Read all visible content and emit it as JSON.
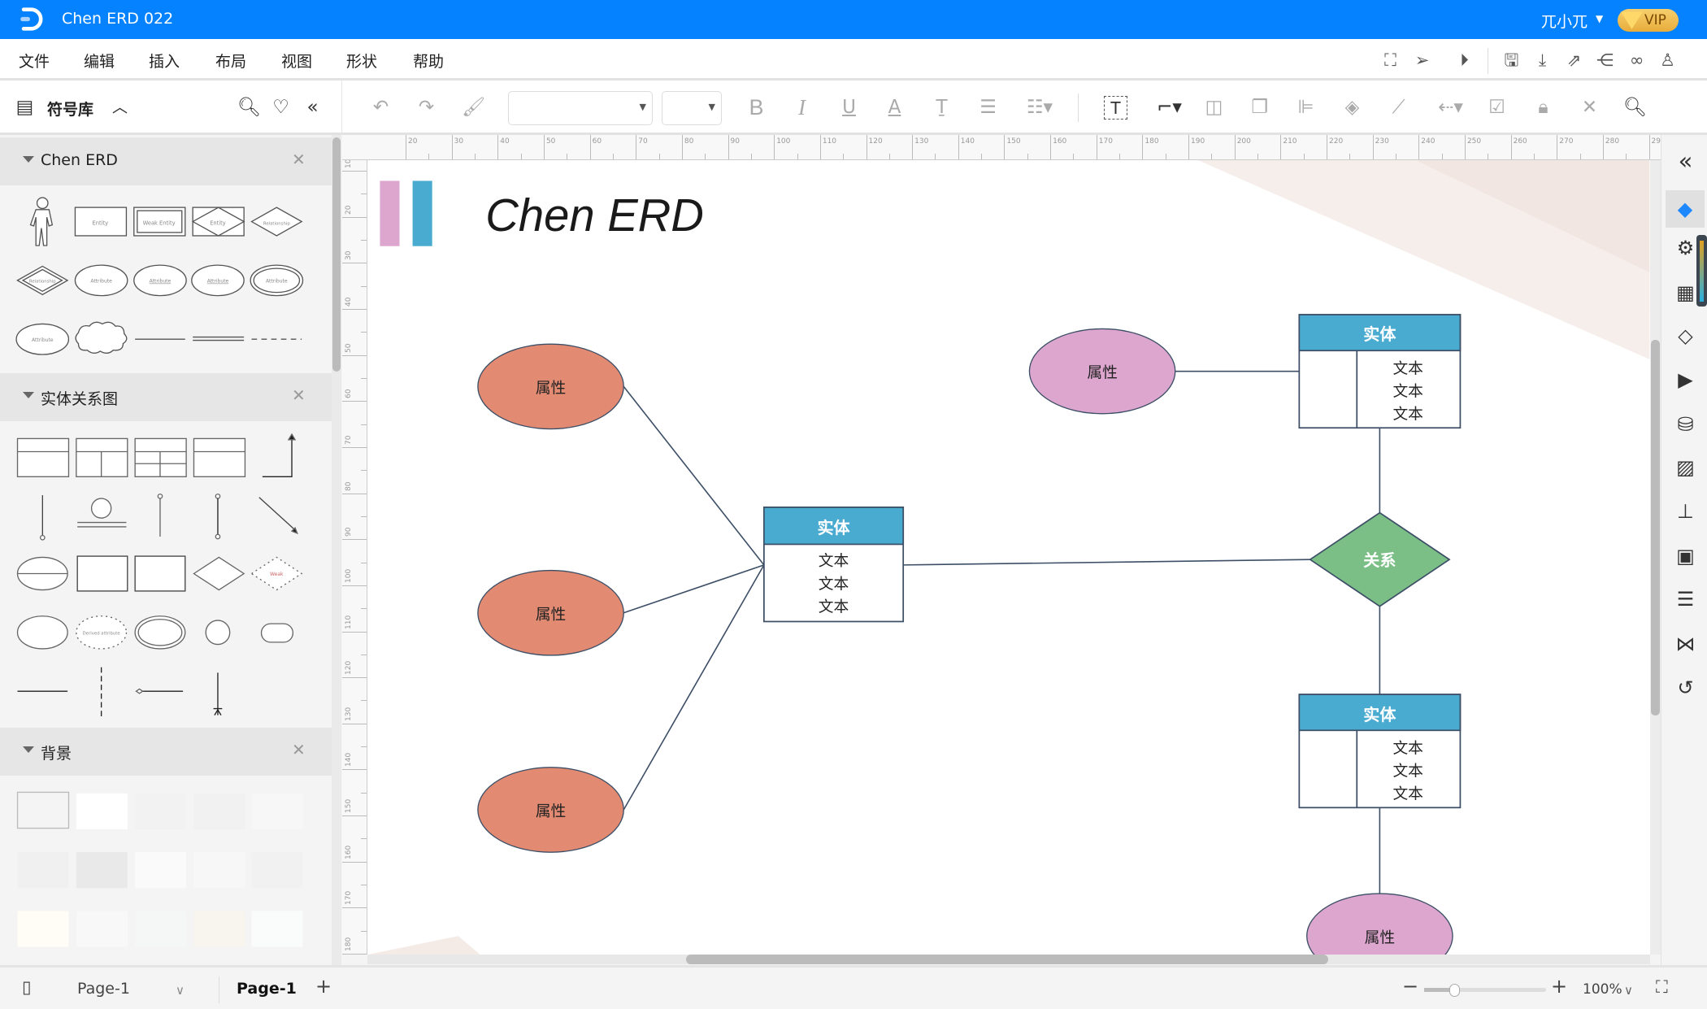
{
  "app": {
    "title": "Chen ERD 022",
    "user": "兀小兀",
    "vip_label": "VIP",
    "brand_color": "#0582ff"
  },
  "menu": {
    "items": [
      "文件",
      "编辑",
      "插入",
      "布局",
      "视图",
      "形状",
      "帮助"
    ],
    "right_icons": [
      "fit-page-icon",
      "send-icon",
      "play-icon",
      "save-icon",
      "download-icon",
      "export-icon",
      "share-icon",
      "binoculars-icon",
      "shirt-icon"
    ]
  },
  "toolbar": {
    "library_label": "符号库",
    "font_value": "",
    "size_value": "",
    "icons": [
      "undo-icon",
      "redo-icon",
      "format-painter-icon",
      "bold-icon",
      "italic-icon",
      "underline-icon",
      "font-color-icon",
      "text-style-icon",
      "align-icon",
      "line-spacing-icon",
      "text-box-icon",
      "connector-icon",
      "bring-front-icon",
      "send-back-icon",
      "distribute-icon",
      "fill-icon",
      "line-color-icon",
      "line-style-icon",
      "edit-style-icon",
      "lock-icon",
      "tools-icon",
      "search-icon"
    ]
  },
  "library": {
    "sections": [
      {
        "name": "Chen ERD",
        "labels": {
          "entity": "Entity",
          "weak_entity": "Weak Entity",
          "relationship": "Relationship",
          "attribute": "Attribute"
        }
      },
      {
        "name": "实体关系图",
        "labels": {
          "weak": "Weak",
          "derived": "Derived attribute"
        }
      },
      {
        "name": "背景"
      }
    ]
  },
  "rulers": {
    "top": [
      "20",
      "30",
      "40",
      "50",
      "60",
      "70",
      "80",
      "90",
      "100",
      "110",
      "120",
      "130",
      "140",
      "150",
      "160",
      "170",
      "180",
      "190",
      "200",
      "210",
      "220",
      "230",
      "240",
      "250",
      "260",
      "270",
      "280",
      "29"
    ],
    "left": [
      "10",
      "20",
      "30",
      "40",
      "50",
      "60",
      "70",
      "80",
      "90",
      "100",
      "110",
      "120",
      "130",
      "140",
      "150",
      "160",
      "170",
      "180"
    ]
  },
  "diagram": {
    "title": "Chen ERD",
    "colors": {
      "attribute_orange": "#e38b72",
      "attribute_pink": "#dda6cf",
      "entity_header": "#4aabd1",
      "relationship": "#7bbf87",
      "stroke": "#3d4f66",
      "legend_pink": "#dda6cf",
      "legend_blue": "#4aabd1"
    },
    "attributes": [
      {
        "label": "属性"
      },
      {
        "label": "属性"
      },
      {
        "label": "属性"
      },
      {
        "label": "属性"
      },
      {
        "label": "属性"
      }
    ],
    "entities": [
      {
        "header": "实体",
        "rows": [
          "文本",
          "文本",
          "文本"
        ]
      },
      {
        "header": "实体",
        "rows": [
          "文本",
          "文本",
          "文本"
        ]
      },
      {
        "header": "实体",
        "rows": [
          "文本",
          "文本",
          "文本"
        ]
      }
    ],
    "relationship": {
      "label": "关系"
    }
  },
  "right_sidebar": {
    "icons": [
      "collapse-icon",
      "fill-style-icon",
      "page-setup-icon",
      "shapes-grid-icon",
      "layers-icon",
      "presentation-icon",
      "database-icon",
      "image-icon",
      "org-chart-icon",
      "puzzle-icon",
      "timeline-icon",
      "mind-map-icon",
      "history-icon"
    ],
    "active": "fill-style-icon"
  },
  "footer": {
    "page_select": "Page-1",
    "page_tab": "Page-1",
    "zoom": "100%",
    "zoom_level_percent": 100
  }
}
